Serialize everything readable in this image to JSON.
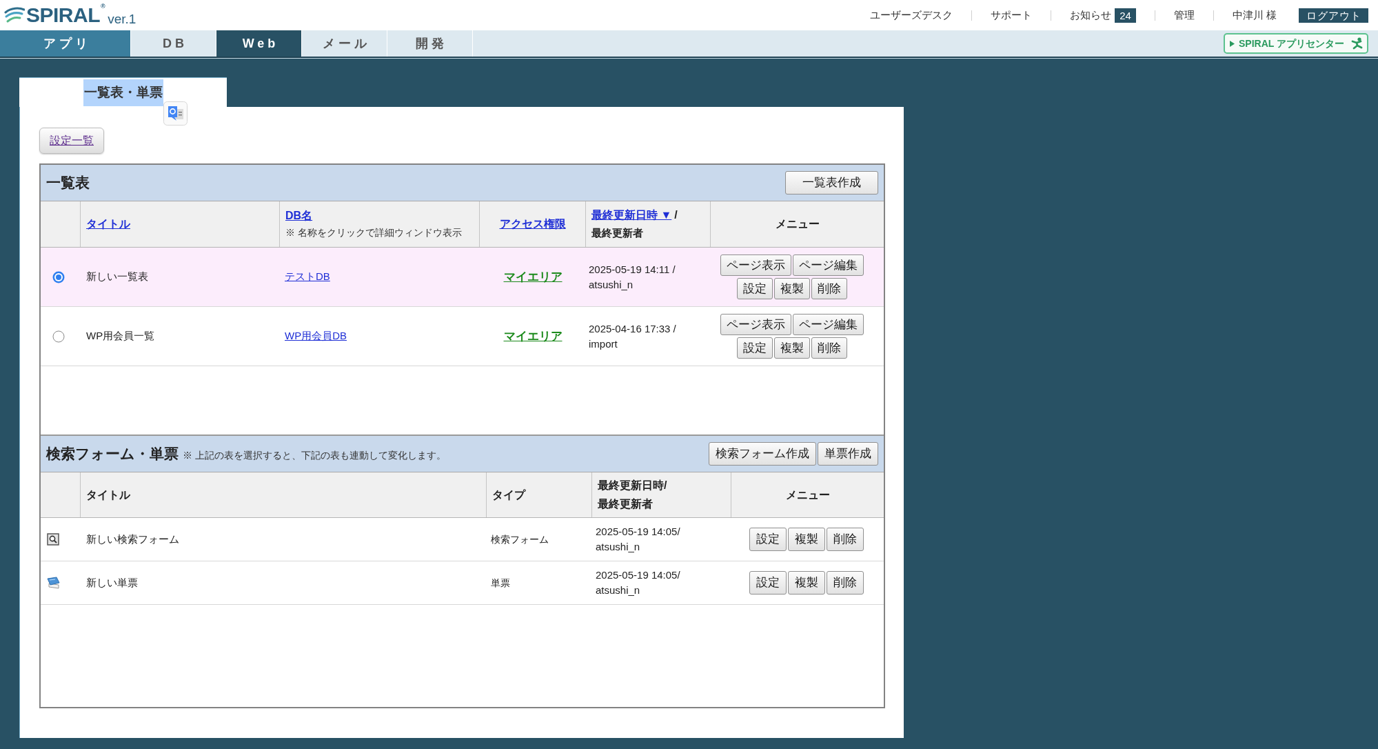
{
  "header": {
    "logo": {
      "name": "SPIRAL$^{®}$",
      "version": "ver.1"
    },
    "links": [
      {
        "label": "ユーザーズデスク"
      },
      {
        "label": "サポート"
      },
      {
        "label": "お知らせ",
        "badge": "24"
      },
      {
        "label": "管理"
      },
      {
        "label": "中津川 様"
      }
    ],
    "logout": "ログアウト"
  },
  "nav": {
    "tabs": [
      {
        "label": "アプリ",
        "selected": false,
        "highlighted": true
      },
      {
        "label": "DB",
        "selected": false,
        "highlighted": false
      },
      {
        "label": "Web",
        "selected": true,
        "highlighted": false
      },
      {
        "label": "メール",
        "selected": false,
        "highlighted": false
      },
      {
        "label": "開発",
        "selected": false,
        "highlighted": false
      }
    ],
    "app_center": "SPIRAL アプリセンター"
  },
  "page_tab": {
    "label": "一覧表・単票",
    "text_selected": true
  },
  "settings_button": "設定一覧",
  "list_section": {
    "title": "一覧表",
    "create_button": "一覧表作成",
    "columns": [
      {
        "label": "タイトル",
        "link": true
      },
      {
        "label": "DB名",
        "link": true,
        "note": "※ 名称をクリックで詳細ウィンドウ表示"
      },
      {
        "label": "アクセス権限",
        "link": true
      },
      {
        "label": "最終更新日時 ▼",
        "link": true,
        "suffix": "/",
        "sub": "最終更新者"
      },
      {
        "label": "メニュー",
        "link": false
      }
    ],
    "rows": [
      {
        "selected": true,
        "title": "新しい一覧表",
        "db": "テストDB",
        "access": "マイエリア",
        "updated": "2025-05-19 14:11 /",
        "updater": "atsushi_n",
        "buttons": [
          [
            "ページ表示",
            "ページ編集"
          ],
          [
            "設定",
            "複製",
            "削除"
          ]
        ]
      },
      {
        "selected": false,
        "title": "WP用会員一覧",
        "db": "WP用会員DB",
        "access": "マイエリア",
        "updated": "2025-04-16 17:33 /",
        "updater": "import",
        "buttons": [
          [
            "ページ表示",
            "ページ編集"
          ],
          [
            "設定",
            "複製",
            "削除"
          ]
        ]
      }
    ]
  },
  "form_section": {
    "title": "検索フォーム・単票",
    "note": "※ 上記の表を選択すると、下記の表も連動して変化します。",
    "create_buttons": [
      "検索フォーム作成",
      "単票作成"
    ],
    "columns": [
      {
        "label": "タイトル"
      },
      {
        "label": "タイプ"
      },
      {
        "label": "最終更新日時/",
        "sub": "最終更新者"
      },
      {
        "label": "メニュー"
      }
    ],
    "rows": [
      {
        "kind": "search_form",
        "title": "新しい検索フォーム",
        "type": "検索フォーム",
        "updated": "2025-05-19 14:05/",
        "updater": "atsushi_n",
        "buttons": [
          "設定",
          "複製",
          "削除"
        ]
      },
      {
        "kind": "single",
        "title": "新しい単票",
        "type": "単票",
        "updated": "2025-05-19 14:05/",
        "updater": "atsushi_n",
        "buttons": [
          "設定",
          "複製",
          "削除"
        ]
      }
    ]
  }
}
